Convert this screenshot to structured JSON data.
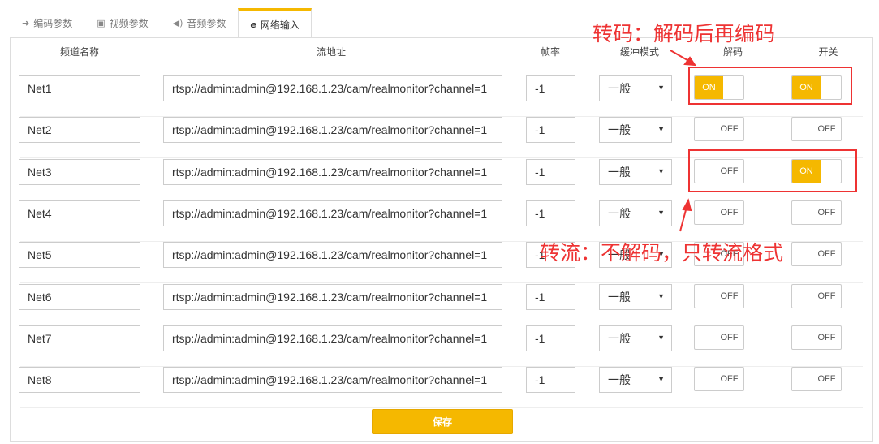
{
  "tabs": [
    {
      "label": "编码参数",
      "icon": "arrow-in-icon",
      "glyph": "➜"
    },
    {
      "label": "视频参数",
      "icon": "image-icon",
      "glyph": "▣"
    },
    {
      "label": "音频参数",
      "icon": "speaker-icon",
      "glyph": "◀)"
    },
    {
      "label": "网络输入",
      "icon": "ie-icon",
      "glyph": "e"
    }
  ],
  "active_tab": 3,
  "headers": {
    "name": "频道名称",
    "url": "流地址",
    "fps": "帧率",
    "buffer": "缓冲模式",
    "decode": "解码",
    "switch": "开关"
  },
  "rows": [
    {
      "name": "Net1",
      "url": "rtsp://admin:admin@192.168.1.23/cam/realmonitor?channel=1",
      "fps": "-1",
      "buffer": "一般",
      "decode": "ON",
      "switch": "ON"
    },
    {
      "name": "Net2",
      "url": "rtsp://admin:admin@192.168.1.23/cam/realmonitor?channel=1",
      "fps": "-1",
      "buffer": "一般",
      "decode": "OFF",
      "switch": "OFF"
    },
    {
      "name": "Net3",
      "url": "rtsp://admin:admin@192.168.1.23/cam/realmonitor?channel=1",
      "fps": "-1",
      "buffer": "一般",
      "decode": "OFF",
      "switch": "ON"
    },
    {
      "name": "Net4",
      "url": "rtsp://admin:admin@192.168.1.23/cam/realmonitor?channel=1",
      "fps": "-1",
      "buffer": "一般",
      "decode": "OFF",
      "switch": "OFF"
    },
    {
      "name": "Net5",
      "url": "rtsp://admin:admin@192.168.1.23/cam/realmonitor?channel=1",
      "fps": "-1",
      "buffer": "一般",
      "decode": "OFF",
      "switch": "OFF"
    },
    {
      "name": "Net6",
      "url": "rtsp://admin:admin@192.168.1.23/cam/realmonitor?channel=1",
      "fps": "-1",
      "buffer": "一般",
      "decode": "OFF",
      "switch": "OFF"
    },
    {
      "name": "Net7",
      "url": "rtsp://admin:admin@192.168.1.23/cam/realmonitor?channel=1",
      "fps": "-1",
      "buffer": "一般",
      "decode": "OFF",
      "switch": "OFF"
    },
    {
      "name": "Net8",
      "url": "rtsp://admin:admin@192.168.1.23/cam/realmonitor?channel=1",
      "fps": "-1",
      "buffer": "一般",
      "decode": "OFF",
      "switch": "OFF"
    }
  ],
  "save_label": "保存",
  "annotations": {
    "transcode": "转码：解码后再编码",
    "transflow": "转流：不解码，只转流格式"
  },
  "colors": {
    "accent": "#f5b800",
    "annotation": "#ee3333"
  }
}
